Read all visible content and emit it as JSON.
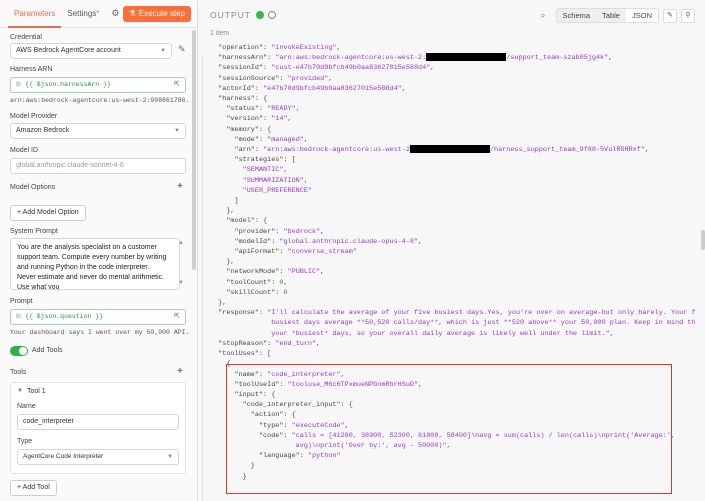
{
  "left": {
    "tabs": {
      "parameters": "Parameters",
      "settings": "Settings",
      "settings_marker": "*"
    },
    "execute_button": "Execute step",
    "credential": {
      "label": "Credential",
      "value": "AWS Bedrock AgentCore account"
    },
    "harness_arn": {
      "label": "Harness ARN",
      "expr": "{{ $json.harnessArn }}",
      "preview": "arn:aws:bedrock-agentcore:us-west-2:908661786..."
    },
    "model_provider": {
      "label": "Model Provider",
      "value": "Amazon Bedrock"
    },
    "model_id": {
      "label": "Model ID",
      "placeholder": "global.anthropic.claude-sonnet-4-6"
    },
    "model_options": {
      "label": "Model Options",
      "add_button": "+ Add Model Option"
    },
    "system_prompt": {
      "label": "System Prompt",
      "value": "You are the analysis specialist on a customer support team. Compute every number by writing and running Python in the code interpreter. Never estimate and never do mental arithmetic. Use what you"
    },
    "prompt": {
      "label": "Prompt",
      "expr": "{{ $json.question }}",
      "preview": "Your dashboard says I went over my 50,000 API..."
    },
    "add_tools": {
      "label": "Add Tools",
      "on": true
    },
    "tools": {
      "label": "Tools",
      "tool1": {
        "header": "Tool 1",
        "name_label": "Name",
        "name_value": "code_interpreter",
        "type_label": "Type",
        "type_value": "AgentCore Code Interpreter"
      },
      "add_button": "+ Add Tool"
    }
  },
  "output": {
    "title": "OUTPUT",
    "views": [
      "Schema",
      "Table",
      "JSON"
    ],
    "active_view": "JSON",
    "item_count": "1 item",
    "lines": [
      {
        "i": 2,
        "k": "\"operation\"",
        "v": "\"invokeExisting\"",
        "t": "s",
        "c": ","
      },
      {
        "i": 2,
        "k": "\"harnessArn\"",
        "v": "\"arn:aws:bedrock-agentcore:us-west-2:",
        "t": "s",
        "red": true,
        "v2": "/support_team-szab05jg4k\"",
        "c": ","
      },
      {
        "i": 2,
        "k": "\"sessionId\"",
        "v": "\"cust-e47b70d9bfcb49b0aa83627015e588d4\"",
        "t": "s",
        "c": ","
      },
      {
        "i": 2,
        "k": "\"sessionSource\"",
        "v": "\"provided\"",
        "t": "s",
        "c": ","
      },
      {
        "i": 2,
        "k": "\"actorId\"",
        "v": "\"e47b70d9bfcb49b0aa83627015e588d4\"",
        "t": "s",
        "c": ","
      },
      {
        "i": 2,
        "k": "\"harness\"",
        "v": "{",
        "t": "p",
        "c": ""
      },
      {
        "i": 4,
        "k": "\"status\"",
        "v": "\"READY\"",
        "t": "s",
        "c": ","
      },
      {
        "i": 4,
        "k": "\"version\"",
        "v": "\"14\"",
        "t": "s",
        "c": ","
      },
      {
        "i": 4,
        "k": "\"memory\"",
        "v": "{",
        "t": "p",
        "c": ""
      },
      {
        "i": 6,
        "k": "\"mode\"",
        "v": "\"managed\"",
        "t": "s",
        "c": ","
      },
      {
        "i": 6,
        "k": "\"arn\"",
        "v": "\"arn:aws:bedrock-agentcore:us-west-2",
        "t": "s",
        "red": true,
        "v2": "/harness_support_team_9f88-5VulRGHRxf\"",
        "c": ","
      },
      {
        "i": 6,
        "k": "\"strategies\"",
        "v": "[",
        "t": "p",
        "c": ""
      },
      {
        "i": 8,
        "k": "",
        "v": "\"SEMANTIC\"",
        "t": "s",
        "c": ","
      },
      {
        "i": 8,
        "k": "",
        "v": "\"SUMMARIZATION\"",
        "t": "s",
        "c": ","
      },
      {
        "i": 8,
        "k": "",
        "v": "\"USER_PREFERENCE\"",
        "t": "s",
        "c": ""
      },
      {
        "i": 6,
        "k": "",
        "v": "]",
        "t": "p",
        "c": ""
      },
      {
        "i": 4,
        "k": "",
        "v": "}",
        "t": "p",
        "c": ","
      },
      {
        "i": 4,
        "k": "\"model\"",
        "v": "{",
        "t": "p",
        "c": ""
      },
      {
        "i": 6,
        "k": "\"provider\"",
        "v": "\"bedrock\"",
        "t": "s",
        "c": ","
      },
      {
        "i": 6,
        "k": "\"modelId\"",
        "v": "\"global.anthropic.claude-opus-4-8\"",
        "t": "s",
        "c": ","
      },
      {
        "i": 6,
        "k": "\"apiFormat\"",
        "v": "\"converse_stream\"",
        "t": "s",
        "c": ""
      },
      {
        "i": 4,
        "k": "",
        "v": "}",
        "t": "p",
        "c": ","
      },
      {
        "i": 4,
        "k": "\"networkMode\"",
        "v": "\"PUBLIC\"",
        "t": "s",
        "c": ","
      },
      {
        "i": 4,
        "k": "\"toolCount\"",
        "v": "0",
        "t": "n",
        "c": ","
      },
      {
        "i": 4,
        "k": "\"skillCount\"",
        "v": "0",
        "t": "n",
        "c": ""
      },
      {
        "i": 2,
        "k": "",
        "v": "}",
        "t": "p",
        "c": ","
      },
      {
        "i": 2,
        "k": "\"response\"",
        "v": "\"I'll calculate the average of your five busiest days.Yes, you're over on average-but only barely. Your five",
        "t": "s",
        "c": ""
      },
      {
        "i": 15,
        "k": "",
        "v": "busiest days average **50,520 calls/day**, which is just **520 above** your 50,000 plan. Keep in mind these are",
        "t": "s",
        "c": ""
      },
      {
        "i": 15,
        "k": "",
        "v": "your *busiest* days, so your overall daily average is likely well under the limit.\"",
        "t": "s",
        "c": ","
      },
      {
        "i": 2,
        "k": "\"stopReason\"",
        "v": "\"end_turn\"",
        "t": "s",
        "c": ","
      },
      {
        "i": 2,
        "k": "\"toolUses\"",
        "v": "[",
        "t": "p",
        "c": ""
      },
      {
        "i": 4,
        "k": "",
        "v": "{",
        "t": "p",
        "c": ""
      },
      {
        "i": 6,
        "k": "\"name\"",
        "v": "\"code_interpreter\"",
        "t": "s",
        "c": ","
      },
      {
        "i": 6,
        "k": "\"toolUseId\"",
        "v": "\"tooluse_M6c6TPxmueNPGnmRbrHSuD\"",
        "t": "s",
        "c": ","
      },
      {
        "i": 6,
        "k": "\"input\"",
        "v": "{",
        "t": "p",
        "c": ""
      },
      {
        "i": 8,
        "k": "\"code_interpreter_input\"",
        "v": "{",
        "t": "p",
        "c": ""
      },
      {
        "i": 10,
        "k": "\"action\"",
        "v": "{",
        "t": "p",
        "c": ""
      },
      {
        "i": 12,
        "k": "\"type\"",
        "v": "\"executeCode\"",
        "t": "s",
        "c": ","
      },
      {
        "i": 12,
        "k": "\"code\"",
        "v": "\"calls = [41200, 38900, 52300, 61800, 58400]\\navg = sum(calls) / len(calls)\\nprint('Average:',",
        "t": "s",
        "c": ""
      },
      {
        "i": 21,
        "k": "",
        "v": "avg)\\nprint('Over by:', avg - 50000)\"",
        "t": "s",
        "c": ","
      },
      {
        "i": 12,
        "k": "\"language\"",
        "v": "\"python\"",
        "t": "s",
        "c": ""
      },
      {
        "i": 10,
        "k": "",
        "v": "}",
        "t": "p",
        "c": ""
      },
      {
        "i": 8,
        "k": "",
        "v": "}",
        "t": "p",
        "c": ""
      }
    ]
  },
  "colors": {
    "accent": "#ff6d3a",
    "json_string": "#9b35c9",
    "json_number": "#3c8c3c",
    "toggle_on": "#2fb344",
    "highlight_box": "#e0392b"
  }
}
